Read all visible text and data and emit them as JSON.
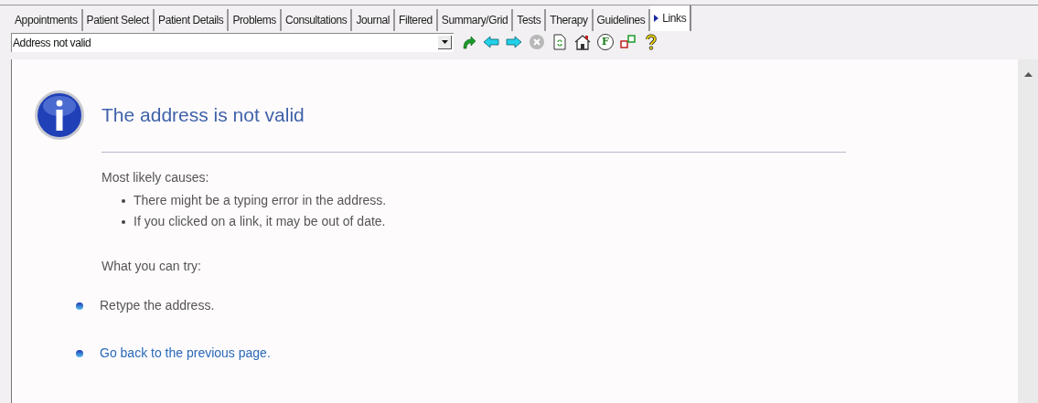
{
  "tabs": [
    {
      "label": "Appointments",
      "selected": false
    },
    {
      "label": "Patient Select",
      "selected": false
    },
    {
      "label": "Patient Details",
      "selected": false
    },
    {
      "label": "Problems",
      "selected": false
    },
    {
      "label": "Consultations",
      "selected": false
    },
    {
      "label": "Journal",
      "selected": false
    },
    {
      "label": "Filtered",
      "selected": false
    },
    {
      "label": "Summary/Grid",
      "selected": false
    },
    {
      "label": "Tests",
      "selected": false
    },
    {
      "label": "Therapy",
      "selected": false
    },
    {
      "label": "Guidelines",
      "selected": false
    },
    {
      "label": "Links",
      "selected": true
    }
  ],
  "address_bar": {
    "value": "Address not valid"
  },
  "toolbar": [
    {
      "kind": "go"
    },
    {
      "kind": "back"
    },
    {
      "kind": "forward"
    },
    {
      "kind": "stop"
    },
    {
      "kind": "refresh"
    },
    {
      "kind": "home"
    },
    {
      "kind": "letter",
      "label": "F"
    },
    {
      "kind": "windows"
    },
    {
      "kind": "help"
    }
  ],
  "page": {
    "title": "The address is not valid",
    "causes_heading": "Most likely causes:",
    "causes": [
      "There might be a typing error in the address.",
      "If you clicked on a link, it may be out of date."
    ],
    "try_heading": "What you can try:",
    "actions": [
      {
        "text": "Retype the address.",
        "kind": "text"
      },
      {
        "text": "Go back to the previous page.",
        "kind": "link"
      }
    ]
  }
}
